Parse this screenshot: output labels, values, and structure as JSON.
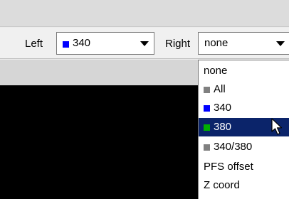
{
  "toolbar": {
    "left_label": "Left",
    "left_value": "340",
    "left_color": "#0000ff",
    "right_label": "Right",
    "right_value": "none"
  },
  "dropdown": {
    "items": [
      {
        "label": "none",
        "color": null,
        "selected": false
      },
      {
        "label": "All",
        "color": "#808080",
        "selected": false
      },
      {
        "label": "340",
        "color": "#0000ff",
        "selected": false
      },
      {
        "label": "380",
        "color": "#00b000",
        "selected": true
      },
      {
        "label": "340/380",
        "color": "#808080",
        "selected": false
      },
      {
        "label": "PFS offset",
        "color": null,
        "selected": false
      },
      {
        "label": "Z coord",
        "color": null,
        "selected": false
      }
    ],
    "selected_bg": "#0b246a"
  }
}
